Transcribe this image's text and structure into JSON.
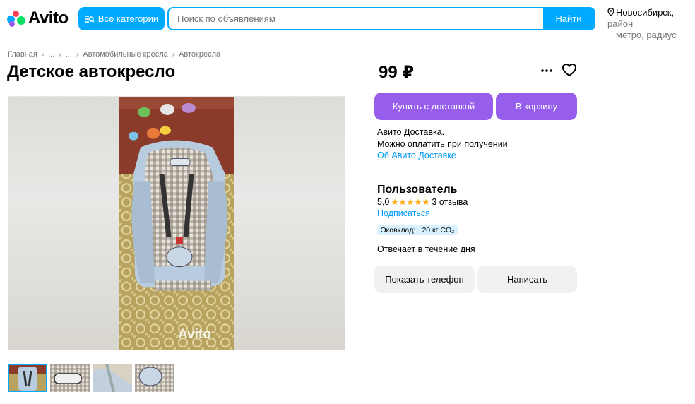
{
  "header": {
    "logo_text": "Avito",
    "categories_label": "Все категории",
    "search_placeholder": "Поиск по объявлениям",
    "search_button": "Найти",
    "location_city": "Новосибирск,",
    "location_line1_rest": "район",
    "location_line2": "метро, радиус"
  },
  "breadcrumb": [
    "Главная",
    "...",
    "...",
    "Автомобильные кресла",
    "Автокресла"
  ],
  "listing": {
    "title": "Детское автокресло",
    "price": "99 ₽",
    "watermark": "Avito",
    "thumbnail_count": 4
  },
  "actions": {
    "buy_with_delivery": "Купить с доставкой",
    "add_to_cart": "В корзину"
  },
  "delivery": {
    "line1": "Авито Доставка.",
    "line2": "Можно оплатить при получении",
    "link": "Об Авито Доставке"
  },
  "seller": {
    "name": "Пользователь",
    "rating": "5,0",
    "stars": 5,
    "reviews": "3 отзыва",
    "subscribe": "Подписаться",
    "eco_badge": "Эковклад: −20 кг CO₂",
    "response_time": "Отвечает в течение дня"
  },
  "contact": {
    "show_phone": "Показать телефон",
    "write": "Написать"
  },
  "colors": {
    "accent_blue": "#00aaff",
    "link_blue": "#0099f7",
    "purple": "#965eeb",
    "gray_button": "#f2f1f0",
    "star": "#ffb021",
    "eco_bg": "#d9f2ff"
  }
}
